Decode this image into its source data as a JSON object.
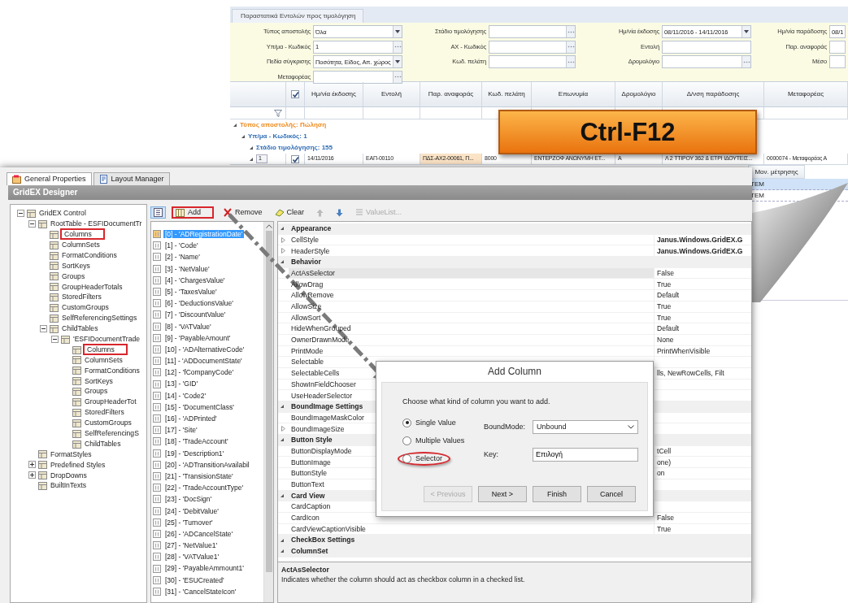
{
  "back_window": {
    "tab": "Παραστατικά Εντολών προς τιμολόγηση",
    "filters": [
      {
        "label": "Τύπος αποστολής",
        "value": "Όλα",
        "kind": "dropdown"
      },
      {
        "label": "Στάδιο τιμολόγησης",
        "kind": "lookup"
      },
      {
        "label": "Ημ/νία έκδοσης",
        "value": "08/11/2016 - 14/11/2016",
        "kind": "dropdown"
      },
      {
        "label": "Ημ/νία παράδοσης",
        "value": "08/1",
        "kind": "text"
      },
      {
        "label": "Υπ/μα - Κωδικός",
        "value": "1",
        "kind": "lookup"
      },
      {
        "label": "ΑΧ - Κωδικός",
        "kind": "lookup"
      },
      {
        "label": "Εντολή",
        "kind": "text"
      },
      {
        "label": "Παρ. αναφοράς",
        "kind": "text"
      },
      {
        "label": "Πεδία σύγκρισης",
        "value": "Ποσότητα, Είδος, Απ. χώρος",
        "kind": "dropdown"
      },
      {
        "label": "Κωδ. πελάτη",
        "kind": "lookup"
      },
      {
        "label": "Δρομολόγιο",
        "kind": "lookup"
      },
      {
        "label": "Μέσο",
        "kind": "text"
      },
      {
        "label": "Μεταφορέας",
        "kind": "lookup"
      }
    ],
    "grid": {
      "header_checked": true,
      "columns": [
        "Ημ/νία έκδοσης",
        "Εντολή",
        "Παρ. αναφοράς",
        "Κωδ. πελάτη",
        "Επωνυμία",
        "Δρομολόγιο",
        "Δ/νση παράδοσης",
        "Μεταφορέας"
      ],
      "groups": [
        {
          "text": "Τύπος αποστολής: Πώληση",
          "color": "#ee8a1c",
          "expanded": true,
          "children": [
            {
              "text": "Υπ/μα - Κωδικός: 1",
              "color": "#2f6db5",
              "expanded": true,
              "children": [
                {
                  "text": "Στάδιο τιμολόγησης: 155",
                  "color": "#2f6db5",
                  "expanded": true
                }
              ]
            }
          ]
        }
      ],
      "rows": [
        {
          "number": "1",
          "expanded": true,
          "checked": true,
          "cells": [
            {
              "text": "14/11/2016",
              "selected": false
            },
            {
              "text": "ΕΑΠ-00110",
              "selected": false
            },
            {
              "text": "ΠΔΣ-ΑΧ2-00061, Π...",
              "selected": true
            },
            {
              "text": "8000",
              "selected": false
            },
            {
              "text": "ΕΝΤΕΡΖΟΦ ΑΝΩΝΥΜΗ ΕΤ...",
              "selected": false
            },
            {
              "text": "Α",
              "selected": false
            },
            {
              "text": "Λ 2 ΤΤΙΡΟΥ 362 & ΕΤΡΙ ΙΔΟΥΤΕΙΣ...",
              "selected": false
            },
            {
              "text": "0000074 - Μεταφορέας Α",
              "selected": false
            }
          ]
        }
      ]
    },
    "detail_grid": {
      "header": "Μον. μέτρησης",
      "rows": [
        {
          "text": "TEM",
          "selected": true
        },
        {
          "text": "TEM",
          "selected": false
        }
      ]
    }
  },
  "banner": {
    "text": "Ctrl-F12"
  },
  "designer": {
    "tabs": [
      {
        "label": "General Properties",
        "selected": true
      },
      {
        "label": "Layout Manager",
        "selected": false
      }
    ],
    "title": "GridEX Designer",
    "tree": [
      {
        "label": "GridEX Control",
        "expanded": true,
        "highlighted": false,
        "children": [
          {
            "label": "RootTable - ESFIDocumentTr",
            "expanded": true,
            "highlighted": false,
            "children": [
              {
                "label": "Columns",
                "highlighted": true
              },
              {
                "label": "ColumnSets",
                "highlighted": false
              },
              {
                "label": "FormatConditions",
                "highlighted": false
              },
              {
                "label": "SortKeys",
                "highlighted": false
              },
              {
                "label": "Groups",
                "highlighted": false
              },
              {
                "label": "GroupHeaderTotals",
                "highlighted": false
              },
              {
                "label": "StoredFilters",
                "highlighted": false
              },
              {
                "label": "CustomGroups",
                "highlighted": false
              },
              {
                "label": "SelfReferencingSettings",
                "highlighted": false
              },
              {
                "label": "ChildTables",
                "expanded": true,
                "highlighted": false,
                "children": [
                  {
                    "label": "'ESFIDocumentTrade",
                    "expanded": true,
                    "highlighted": false,
                    "children": [
                      {
                        "label": "Columns",
                        "highlighted": true
                      },
                      {
                        "label": "ColumnSets",
                        "highlighted": false
                      },
                      {
                        "label": "FormatConditions",
                        "highlighted": false
                      },
                      {
                        "label": "SortKeys",
                        "highlighted": false
                      },
                      {
                        "label": "Groups",
                        "highlighted": false
                      },
                      {
                        "label": "GroupHeaderTot",
                        "highlighted": false
                      },
                      {
                        "label": "StoredFilters",
                        "highlighted": false
                      },
                      {
                        "label": "CustomGroups",
                        "highlighted": false
                      },
                      {
                        "label": "SelfReferencingS",
                        "highlighted": false
                      },
                      {
                        "label": "ChildTables",
                        "highlighted": false
                      }
                    ]
                  }
                ]
              }
            ]
          },
          {
            "label": "FormatStyles",
            "highlighted": false
          },
          {
            "label": "Predefined Styles",
            "expanded": false,
            "highlighted": false
          },
          {
            "label": "DropDowns",
            "expanded": false,
            "highlighted": false
          },
          {
            "label": "BuiltInTexts",
            "highlighted": false
          }
        ]
      }
    ],
    "toolbar": [
      {
        "kind": "chooser",
        "selected": true
      },
      {
        "kind": "add",
        "label": "Add",
        "highlighted": true
      },
      {
        "kind": "remove",
        "label": "Remove",
        "highlighted": false
      },
      {
        "kind": "clear",
        "label": "Clear",
        "highlighted": false
      },
      {
        "kind": "up",
        "disabled": true
      },
      {
        "kind": "down",
        "disabled": false
      },
      {
        "kind": "valuelist",
        "label": "ValueList...",
        "disabled": true
      }
    ],
    "columns_list": [
      {
        "label": "[0] - 'ADRegistrationDate'",
        "selected": true
      },
      {
        "label": "[1] - 'Code'",
        "selected": false
      },
      {
        "label": "[2] - 'Name'",
        "selected": false
      },
      {
        "label": "[3] - 'NetValue'",
        "selected": false
      },
      {
        "label": "[4] - 'ChargesValue'",
        "selected": false
      },
      {
        "label": "[5] - 'TaxesValue'",
        "selected": false
      },
      {
        "label": "[6] - 'DeductionsValue'",
        "selected": false
      },
      {
        "label": "[7] - 'DiscountValue'",
        "selected": false
      },
      {
        "label": "[8] - 'VATValue'",
        "selected": false
      },
      {
        "label": "[9] - 'PayableAmount'",
        "selected": false
      },
      {
        "label": "[10] - 'ADAlternativeCode'",
        "selected": false
      },
      {
        "label": "[11] - 'ADDocumentState'",
        "selected": false
      },
      {
        "label": "[12] - 'fCompanyCode'",
        "selected": false
      },
      {
        "label": "[13] - 'GID'",
        "selected": false
      },
      {
        "label": "[14] - 'Code2'",
        "selected": false
      },
      {
        "label": "[15] - 'DocumentClass'",
        "selected": false
      },
      {
        "label": "[16] - 'ADPrinted'",
        "selected": false
      },
      {
        "label": "[17] - 'Site'",
        "selected": false
      },
      {
        "label": "[18] - 'TradeAccount'",
        "selected": false
      },
      {
        "label": "[19] - 'Description1'",
        "selected": false
      },
      {
        "label": "[20] - 'ADTransitionAvailabil",
        "selected": false
      },
      {
        "label": "[21] - 'TransisionState'",
        "selected": false
      },
      {
        "label": "[22] - 'TradeAccountType'",
        "selected": false
      },
      {
        "label": "[23] - 'DocSign'",
        "selected": false
      },
      {
        "label": "[24] - 'DebitValue'",
        "selected": false
      },
      {
        "label": "[25] - 'Turnover'",
        "selected": false
      },
      {
        "label": "[26] - 'ADCancelState'",
        "selected": false
      },
      {
        "label": "[27] - 'NetValue1'",
        "selected": false
      },
      {
        "label": "[28] - 'VATValue1'",
        "selected": false
      },
      {
        "label": "[29] - 'PayableAmmount1'",
        "selected": false
      },
      {
        "label": "[30] - 'ESUCreated'",
        "selected": false
      },
      {
        "label": "[31] - 'CancelStateIcon'",
        "selected": false
      }
    ],
    "properties": [
      {
        "kind": "category",
        "name": "Appearance",
        "expanded": true
      },
      {
        "kind": "expandable",
        "name": "CellStyle",
        "value": "Janus.Windows.GridEX.G",
        "bold": true,
        "selected": false
      },
      {
        "kind": "expandable",
        "name": "HeaderStyle",
        "value": "Janus.Windows.GridEX.G",
        "bold": true,
        "selected": false
      },
      {
        "kind": "category",
        "name": "Behavior",
        "expanded": true
      },
      {
        "kind": "property",
        "name": "ActAsSelector",
        "value": "False",
        "selected": true
      },
      {
        "kind": "property",
        "name": "AllowDrag",
        "value": "True",
        "selected": false
      },
      {
        "kind": "property",
        "name": "AllowRemove",
        "value": "Default",
        "selected": false
      },
      {
        "kind": "property",
        "name": "AllowSize",
        "value": "True",
        "selected": false
      },
      {
        "kind": "property",
        "name": "AllowSort",
        "value": "True",
        "selected": false
      },
      {
        "kind": "property",
        "name": "HideWhenGrouped",
        "value": "Default",
        "selected": false
      },
      {
        "kind": "property",
        "name": "OwnerDrawnMode",
        "value": "None",
        "selected": false
      },
      {
        "kind": "property",
        "name": "PrintMode",
        "value": "PrintWhenVisible",
        "selected": false
      },
      {
        "kind": "property",
        "name": "Selectable",
        "selected": false
      },
      {
        "kind": "property",
        "name": "SelectableCells",
        "value": "lls, NewRowCells, Filt",
        "selected": false
      },
      {
        "kind": "property",
        "name": "ShowInFieldChooser",
        "selected": false
      },
      {
        "kind": "property",
        "name": "UseHeaderSelector",
        "selected": false
      },
      {
        "kind": "category",
        "name": "BoundImage Settings",
        "expanded": true
      },
      {
        "kind": "property",
        "name": "BoundImageMaskColor",
        "selected": false
      },
      {
        "kind": "expandable",
        "name": "BoundImageSize",
        "selected": false
      },
      {
        "kind": "category",
        "name": "Button Style",
        "expanded": true
      },
      {
        "kind": "property",
        "name": "ButtonDisplayMode",
        "value": "tCell",
        "selected": false
      },
      {
        "kind": "property",
        "name": "ButtonImage",
        "value": "one)",
        "selected": false
      },
      {
        "kind": "property",
        "name": "ButtonStyle",
        "value": "on",
        "selected": false
      },
      {
        "kind": "property",
        "name": "ButtonText",
        "selected": false
      },
      {
        "kind": "category",
        "name": "Card View",
        "expanded": true
      },
      {
        "kind": "property",
        "name": "CardCaption",
        "selected": false
      },
      {
        "kind": "property",
        "name": "CardIcon",
        "value": "False",
        "selected": false
      },
      {
        "kind": "property",
        "name": "CardViewCaptionVisible",
        "value": "True",
        "selected": false
      },
      {
        "kind": "category",
        "name": "CheckBox Settings",
        "expanded": true
      },
      {
        "kind": "category",
        "name": "ColumnSet",
        "expanded": true
      }
    ],
    "description": {
      "title": "ActAsSelector",
      "text": "Indicates whether the column should act as checkbox column in a checked list."
    }
  },
  "dialog": {
    "title": "Add Column",
    "prompt": "Choose what kind of column you want to add.",
    "options": [
      {
        "label": "Single Value",
        "selected": true,
        "circled": false
      },
      {
        "label": "Multiple Values",
        "selected": false,
        "circled": false
      },
      {
        "label": "Selector",
        "selected": false,
        "circled": true
      }
    ],
    "bound_mode": {
      "label": "BoundMode:",
      "value": "Unbound"
    },
    "key": {
      "label": "Key:",
      "value": "Επιλογή"
    },
    "buttons": [
      {
        "label": "< Previous",
        "disabled": true
      },
      {
        "label": "Next >",
        "disabled": false
      },
      {
        "label": "Finish",
        "disabled": false
      },
      {
        "label": "Cancel",
        "disabled": false
      }
    ]
  }
}
